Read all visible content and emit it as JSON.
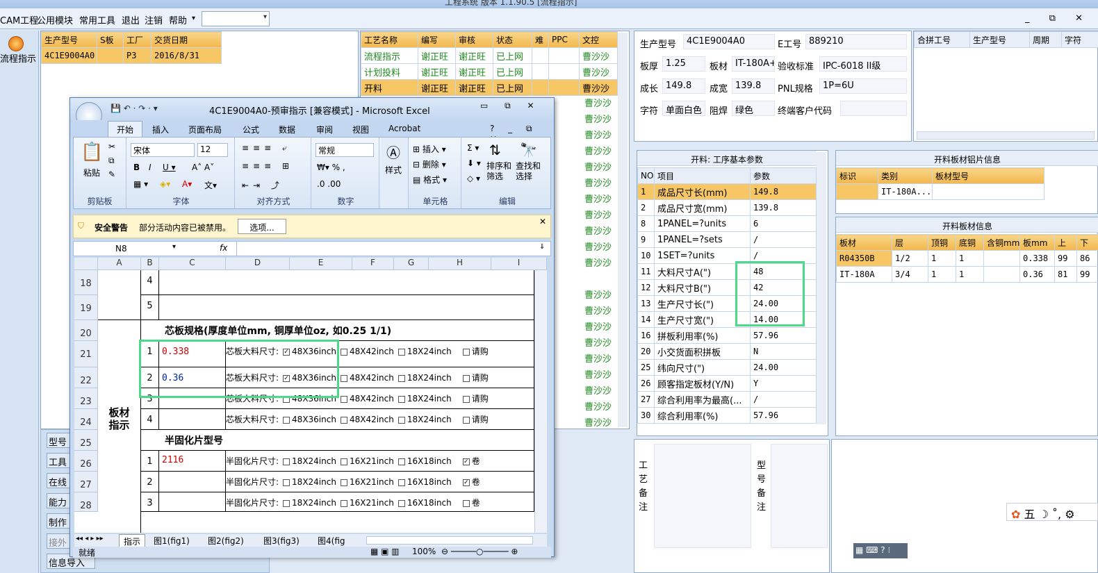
{
  "app": {
    "title": "工程系统 版本 1.1.90.5 [流程指示]"
  },
  "menu": {
    "items": [
      "CAM工程",
      "公用模块",
      "常用工具",
      "退出",
      "注销",
      "帮助"
    ]
  },
  "left": {
    "flow_label": "流程指示",
    "tools": [
      "型号",
      "工具",
      "在线",
      "能力",
      "制作",
      "接外",
      "信息导入"
    ]
  },
  "orders": {
    "headers": [
      "生产型号",
      "S板",
      "工厂",
      "交货日期"
    ],
    "row": [
      "4C1E9004A0",
      "",
      "P3",
      "2016/8/31"
    ]
  },
  "process": {
    "headers": [
      "工艺名称",
      "编写",
      "审核",
      "状态",
      "难",
      "PPC",
      "文控"
    ],
    "rows": [
      [
        "流程指示",
        "谢正旺",
        "谢正旺",
        "已上网",
        "",
        "",
        "曹沙沙"
      ],
      [
        "计划投料",
        "谢正旺",
        "谢正旺",
        "已上网",
        "",
        "",
        "曹沙沙"
      ],
      [
        "开料",
        "谢正旺",
        "谢正旺",
        "已上网",
        "",
        "",
        "曹沙沙"
      ]
    ],
    "extra_owner": "曹沙沙"
  },
  "info": {
    "model_label": "生产型号",
    "model": "4C1E9004A0",
    "eno_label": "E工号",
    "eno": "889210",
    "thick_label": "板厚",
    "thick": "1.25",
    "mat_label": "板材",
    "mat": "IT-180A+",
    "std_label": "验收标准",
    "std": "IPC-6018 II级",
    "len_label": "成长",
    "len": "149.8",
    "wid_label": "成宽",
    "wid": "139.8",
    "pnl_label": "PNL规格",
    "pnl": "1P=6U",
    "char_label": "字符",
    "char": "单面白色",
    "mask_label": "阻焊",
    "mask": "绿色",
    "cust_label": "终端客户代码",
    "cust": ""
  },
  "merge": {
    "headers": [
      "合拼工号",
      "生产型号",
      "周期",
      "字符"
    ]
  },
  "params": {
    "title": "开料: 工序基本参数",
    "headers": [
      "NO",
      "项目",
      "参数"
    ],
    "rows": [
      [
        "1",
        "成品尺寸长(mm)",
        "149.8"
      ],
      [
        "2",
        "成品尺寸宽(mm)",
        "139.8"
      ],
      [
        "8",
        "1PANEL=?units",
        "6"
      ],
      [
        "9",
        "1PANEL=?sets",
        "/"
      ],
      [
        "10",
        "1SET=?units",
        "/"
      ],
      [
        "11",
        "大料尺寸A(\")",
        "48"
      ],
      [
        "12",
        "大料尺寸B(\")",
        "42"
      ],
      [
        "13",
        "生产尺寸长(\")",
        "24.00"
      ],
      [
        "14",
        "生产尺寸宽(\")",
        "14.00"
      ],
      [
        "16",
        "拼板利用率(%)",
        "57.96"
      ],
      [
        "20",
        "小交货面积拼板",
        "N"
      ],
      [
        "25",
        "纬向尺寸(\")",
        "24.00"
      ],
      [
        "26",
        "顾客指定板材(Y/N)",
        "Y"
      ],
      [
        "27",
        "综合利用率为最高(...",
        "/"
      ],
      [
        "30",
        "综合利用率(%)",
        "57.96"
      ]
    ]
  },
  "sheetinfo": {
    "title": "开料板材铝片信息",
    "headers": [
      "标识",
      "类别",
      "板材型号"
    ],
    "row": [
      "",
      "IT-180A...",
      ""
    ]
  },
  "matinfo": {
    "title": "开料板材信息",
    "headers": [
      "板材",
      "层",
      "顶铜",
      "底铜",
      "含铜mm",
      "板mm",
      "上",
      "下"
    ],
    "rows": [
      [
        "R04350B",
        "1/2",
        "1",
        "1",
        "",
        "0.338",
        "99",
        "86"
      ],
      [
        "IT-180A",
        "3/4",
        "1",
        "1",
        "",
        "0.36",
        "81",
        "99"
      ]
    ]
  },
  "notes": {
    "process_label": "工艺备注",
    "model_label": "型号备注"
  },
  "ime": {
    "text": "五"
  },
  "excel": {
    "title": "4C1E9004A0-预审指示 [兼容模式] - Microsoft Excel",
    "tabs": [
      "开始",
      "插入",
      "页面布局",
      "公式",
      "数据",
      "审阅",
      "视图",
      "Acrobat"
    ],
    "font": "宋体",
    "size": "12",
    "numfmt": "常规",
    "groups": [
      "剪贴板",
      "字体",
      "对齐方式",
      "数字",
      "单元格",
      "编辑"
    ],
    "btns": {
      "paste": "粘贴",
      "style": "样式",
      "insert": "插入",
      "delete": "删除",
      "format": "格式",
      "sort": "排序和\n筛选",
      "find": "查找和\n选择"
    },
    "security": {
      "label": "安全警告",
      "msg": "部分活动内容已被禁用。",
      "btn": "选项..."
    },
    "namebox": "N8",
    "fx": "fx",
    "cols": [
      "A",
      "B",
      "C",
      "D",
      "E",
      "F",
      "G",
      "H",
      "I"
    ],
    "rows": [
      "18",
      "19",
      "20",
      "21",
      "22",
      "23",
      "24",
      "25",
      "26",
      "27",
      "28"
    ],
    "section1": "芯板规格(厚度单位mm, 铜厚单位oz, 如0.25 1/1)",
    "section2": "半固化片型号",
    "mat_label": "板材\n指示",
    "core_label": "芯板大料尺寸:",
    "pp_label": "半固化片尺寸:",
    "opts_core": [
      "48X36inch",
      "48X42inch",
      "18X24inch",
      "请购"
    ],
    "opts_pp": [
      "18X24inch",
      "16X21inch",
      "16X18inch",
      "卷"
    ],
    "core_vals": [
      "0.338",
      "0.36",
      "",
      ""
    ],
    "pp_vals": [
      "2116",
      "",
      ""
    ],
    "b_nums": [
      "4",
      "5",
      "1",
      "2",
      "3",
      "4",
      "1",
      "2",
      "3"
    ],
    "sheets": [
      "指示",
      "图1(fig1)",
      "图2(fig2)",
      "图3(fig3)",
      "图4(fig"
    ],
    "status": "就绪",
    "zoom": "100%"
  }
}
